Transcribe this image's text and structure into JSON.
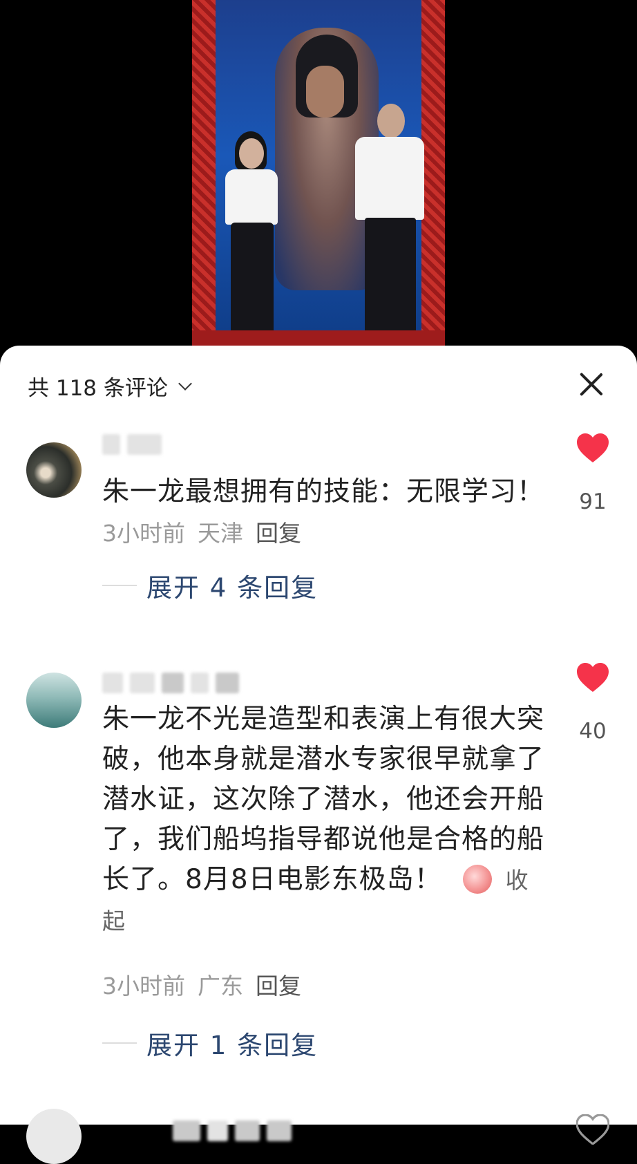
{
  "header": {
    "title": "共 118 条评论"
  },
  "comments": [
    {
      "text": "朱一龙最想拥有的技能：无限学习！",
      "time": "3小时前",
      "location": "天津",
      "reply": "回复",
      "likes": "91",
      "expand": "展开 4 条回复"
    },
    {
      "text": "朱一龙不光是造型和表演上有很大突破，他本身就是潜水专家很早就拿了潜水证，这次除了潜水，他还会开船了，我们船坞指导都说他是合格的船长了。8月8日电影东极岛！",
      "collapse": "收起",
      "time": "3小时前",
      "location": "广东",
      "reply": "回复",
      "likes": "40",
      "expand": "展开 1 条回复"
    }
  ],
  "icons": {
    "like": "heart-icon",
    "close": "close-icon",
    "chevron": "chevron-down-icon"
  },
  "colors": {
    "like_red": "#f5334a",
    "expand_blue": "#2c4770",
    "meta_gray": "#9a9a9a"
  }
}
